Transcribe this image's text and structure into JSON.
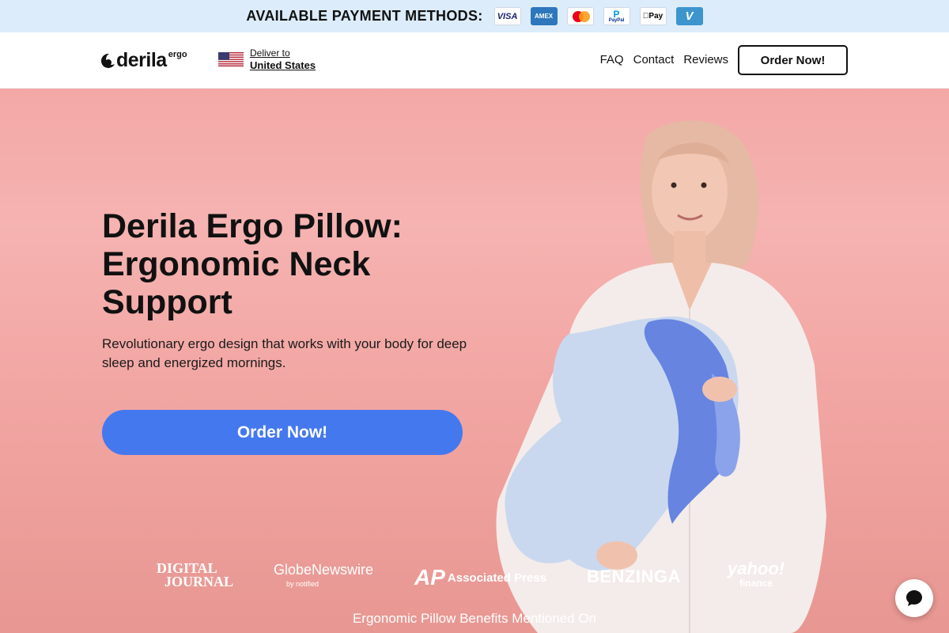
{
  "payment_strip": {
    "title": "AVAILABLE PAYMENT METHODS:",
    "methods": [
      {
        "icon": "visa-icon",
        "label": "VISA"
      },
      {
        "icon": "amex-icon",
        "label": "AMEX"
      },
      {
        "icon": "mastercard-icon",
        "label": ""
      },
      {
        "icon": "paypal-icon",
        "label": "PayPal"
      },
      {
        "icon": "apple-pay-icon",
        "label": "Pay"
      },
      {
        "icon": "venmo-icon",
        "label": "V"
      }
    ],
    "background": "#dcecfa"
  },
  "header": {
    "logo": {
      "word": "derila",
      "sub": "ergo"
    },
    "deliver": {
      "label": "Deliver to",
      "country": "United States",
      "flag_icon": "us-flag-icon"
    },
    "nav": [
      "FAQ",
      "Contact",
      "Reviews"
    ],
    "cta": "Order Now!"
  },
  "hero": {
    "title": "Derila Ergo Pillow: Ergonomic Neck Support",
    "subtitle": "Revolutionary ergo design that works with your body for deep sleep and energized mornings.",
    "cta": "Order Now!",
    "cta_color": "#4478ee",
    "background": "#f3a8a6"
  },
  "press": {
    "logos": [
      {
        "line1": "DIGITAL",
        "line2": "JOURNAL"
      },
      {
        "line1": "GlobeNewswire",
        "line2": "by notified"
      },
      {
        "line1": "AP",
        "line2": "Associated Press"
      },
      {
        "line1": "BENZINGA"
      },
      {
        "line1": "yahoo!",
        "line2": "finance"
      }
    ],
    "caption": "Ergonomic Pillow Benefits Mentioned On"
  },
  "chat": {
    "icon": "chat-bubble-icon"
  }
}
